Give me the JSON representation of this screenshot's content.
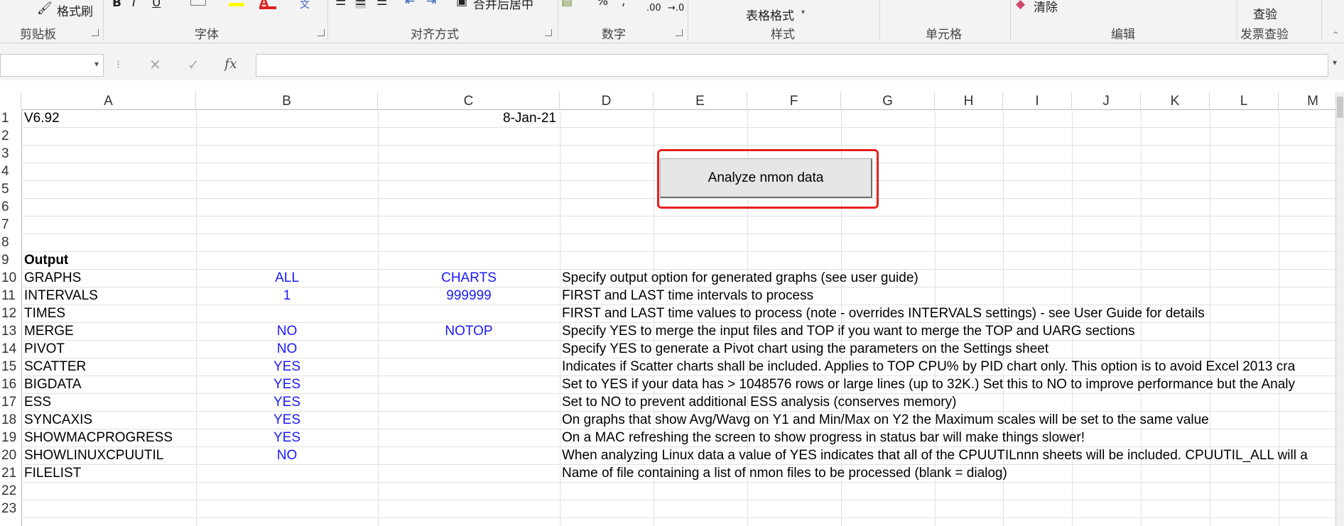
{
  "ribbon": {
    "clipboard": {
      "format_painter": "格式刷",
      "group": "剪贴板"
    },
    "font": {
      "group": "字体",
      "bold": "B",
      "italic": "I",
      "underline": "U",
      "font_color_letter": "A",
      "phonetic": "文"
    },
    "alignment": {
      "merge_center": "合并后居中",
      "group": "对齐方式"
    },
    "number": {
      "percent": "%",
      "comma": ",",
      "inc_decimal": ".00",
      "dec_decimal": "→.0",
      "group": "数字"
    },
    "styles": {
      "format_as_table": "表格格式",
      "group": "样式"
    },
    "cells": {
      "group": "单元格"
    },
    "editing": {
      "clear": "清除",
      "group": "编辑"
    },
    "invoice": {
      "check": "查验",
      "group": "发票查验"
    }
  },
  "formula_bar": {
    "name_box": "",
    "cancel": "✕",
    "enter": "✓",
    "fx": "fx",
    "content": ""
  },
  "columns": [
    "A",
    "B",
    "C",
    "D",
    "E",
    "F",
    "G",
    "H",
    "I",
    "J",
    "K",
    "L",
    "M"
  ],
  "rows": [
    "1",
    "2",
    "3",
    "4",
    "5",
    "6",
    "7",
    "8",
    "9",
    "10",
    "11",
    "12",
    "13",
    "14",
    "15",
    "16",
    "17",
    "18",
    "19",
    "20",
    "21",
    "22",
    "23"
  ],
  "cells": {
    "a1": "V6.92",
    "c1": "8-Jan-21",
    "a9": "Output",
    "a10": "GRAPHS",
    "b10": "ALL",
    "c10": "CHARTS",
    "d10": "Specify output option for generated graphs (see user guide)",
    "a11": "INTERVALS",
    "b11": "1",
    "c11": "999999",
    "d11": "FIRST and LAST time intervals to process",
    "a12": "TIMES",
    "d12": "FIRST and LAST time values to process (note - overrides INTERVALS settings) - see User Guide for details",
    "a13": "MERGE",
    "b13": "NO",
    "c13": "NOTOP",
    "d13": "Specify YES to merge the input files and TOP if you want to merge the TOP and UARG sections",
    "a14": "PIVOT",
    "b14": "NO",
    "d14": "Specify YES to generate a Pivot chart using the parameters on the Settings sheet",
    "a15": "SCATTER",
    "b15": "YES",
    "d15": "Indicates if Scatter charts shall be included.  Applies to TOP CPU% by PID chart only.  This option is to avoid Excel 2013 cra",
    "a16": "BIGDATA",
    "b16": "YES",
    "d16": "Set to YES if your data has > 1048576 rows or large lines (up to 32K.)  Set this to NO to improve performance but the Analy",
    "a17": "ESS",
    "b17": "YES",
    "d17": "Set to NO to prevent additional ESS analysis (conserves memory)",
    "a18": "SYNCAXIS",
    "b18": "YES",
    "d18": "On graphs that show Avg/Wavg on Y1 and Min/Max on Y2 the Maximum scales will be set to the same value",
    "a19": "SHOWMACPROGRESS",
    "b19": "YES",
    "d19": "On a MAC refreshing the screen to show progress in status bar will make things slower!",
    "a20": "SHOWLINUXCPUUTIL",
    "b20": "NO",
    "d20": "When analyzing Linux data a value of YES indicates that all of the CPUUTILnnn sheets will be included.  CPUUTIL_ALL will a",
    "a21": "FILELIST",
    "d21": "Name of file containing a list of nmon files to be processed (blank = dialog)"
  },
  "button": {
    "label": "Analyze nmon data"
  },
  "colors": {
    "value_blue": "#1a1aff",
    "highlight_red": "#e82020"
  }
}
